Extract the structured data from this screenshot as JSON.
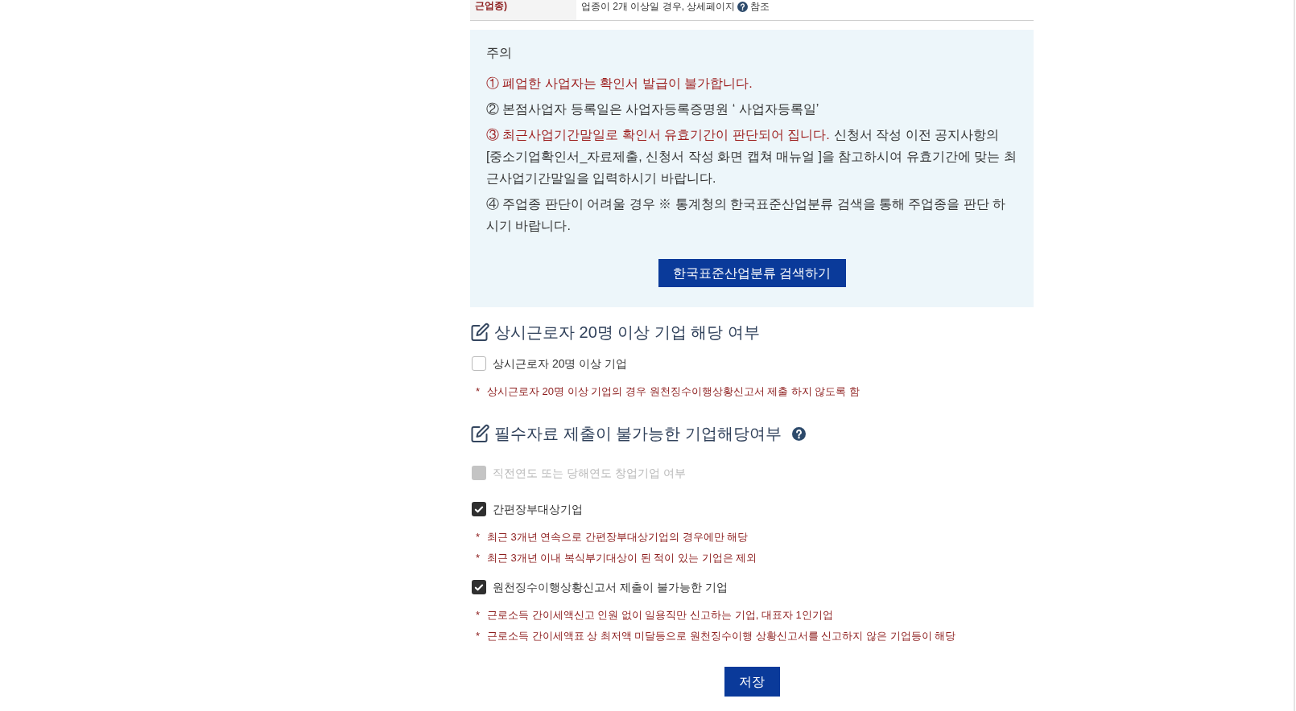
{
  "info_row": {
    "label": "근업종)",
    "text": "업종이 2개 이상일 경우, 상세페이지",
    "help_icon": true,
    "text_after_icon": "참조"
  },
  "notice": {
    "title": "주의",
    "items": [
      {
        "highlight": "① 폐업한 사업자는 확인서 발급이 불가합니다."
      },
      {
        "text": "② 본점사업자 등록일은 사업자등록증명원 ‘ 사업자등록일’"
      },
      {
        "highlight": "③ 최근사업기간말일로 확인서 유효기간이 판단되어 집니다.",
        "text": "신청서 작성 이전 공지사항의 [중소기업확인서_자료제출, 신청서 작성 화면 캡쳐 매뉴얼 ]을 참고하시여 유효기간에 맞는 최근사업기간말일을 입력하시기 바랍니다."
      },
      {
        "text": "④ 주업종 판단이 어려울 경우 ※ 통계청의 한국표준산업분류 검색을 통해 주업종을 판단 하시기 바랍니다."
      }
    ],
    "button": "한국표준산업분류 검색하기"
  },
  "sections": [
    {
      "title": "상시근로자 20명 이상 기업 해당 여부",
      "help_icon": false,
      "options": [
        {
          "label": "상시근로자 20명 이상 기업",
          "checked": false,
          "disabled": false,
          "notes": [
            {
              "marker": "*",
              "text": "상시근로자 20명 이상 기업의 경우 원천징수이행상황신고서 제출 하지 않도록 함"
            }
          ]
        }
      ]
    },
    {
      "title": "필수자료 제출이 불가능한 기업해당여부",
      "help_icon": true,
      "options": [
        {
          "label": "직전연도 또는 당해연도 창업기업 여부",
          "checked": false,
          "disabled": true
        },
        {
          "label": "간편장부대상기업",
          "checked": true,
          "disabled": false,
          "notes": [
            {
              "marker": "*",
              "text": "최근 3개년 연속으로 간편장부대상기업의 경우에만 해당"
            },
            {
              "marker": "*",
              "text": "최근 3개년 이내 복식부기대상이 된 적이 있는 기업은 제외"
            }
          ]
        },
        {
          "label": "원천징수이행상황신고서 제출이 불가능한 기업",
          "checked": true,
          "disabled": false,
          "notes": [
            {
              "marker": "*",
              "text": "근로소득 간이세액신고 인원 없이 일용직만 신고하는 기업, 대표자 1인기업"
            },
            {
              "marker": "*",
              "text": "근로소득 간이세액표 상 최저액 미달등으로 원천징수이행 상황신고서를 신고하지 않은 기업등이 해당"
            }
          ]
        }
      ]
    }
  ],
  "save_button": "저장"
}
